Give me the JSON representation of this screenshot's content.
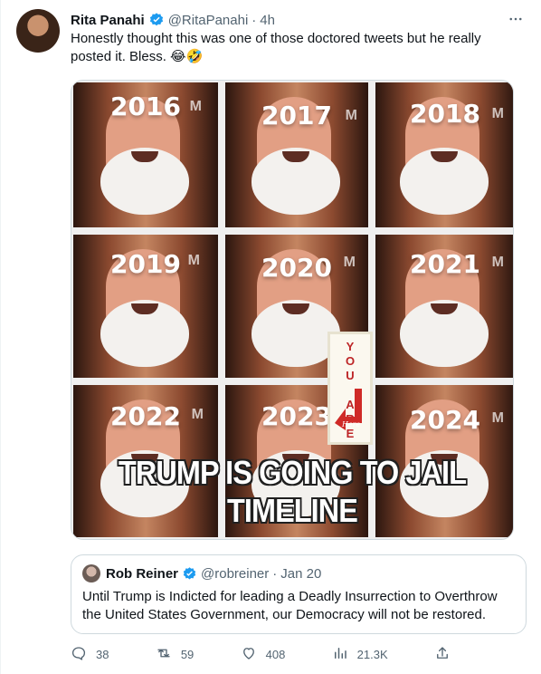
{
  "tweet": {
    "author_name": "Rita Panahi",
    "author_handle": "@RitaPanahi",
    "separator": "·",
    "time": "4h",
    "text_line1": "Honestly thought this was one of those doctored tweets but he really",
    "text_line2": "posted it. Bless. 😂🤣",
    "verified_color": "#1d9bf0"
  },
  "media": {
    "years": [
      "2016",
      "2017",
      "2018",
      "2019",
      "2020",
      "2021",
      "2022",
      "2023",
      "2024"
    ],
    "you_are": "YOU ARE",
    "here": "Here",
    "caption": "TRUMP IS GOING TO JAIL TIMELINE"
  },
  "quoted": {
    "author_name": "Rob Reiner",
    "author_handle": "@robreiner",
    "separator": "·",
    "time": "Jan 20",
    "text_line1": "Until Trump is Indicted for leading a Deadly Insurrection to Overthrow",
    "text_line2": "the United States Government, our Democracy will not be restored."
  },
  "actions": {
    "replies": "38",
    "retweets": "59",
    "likes": "408",
    "views": "21.3K"
  },
  "icons": [
    "more-icon",
    "verified-badge-icon",
    "reply-icon",
    "retweet-icon",
    "like-icon",
    "views-icon",
    "share-icon"
  ]
}
